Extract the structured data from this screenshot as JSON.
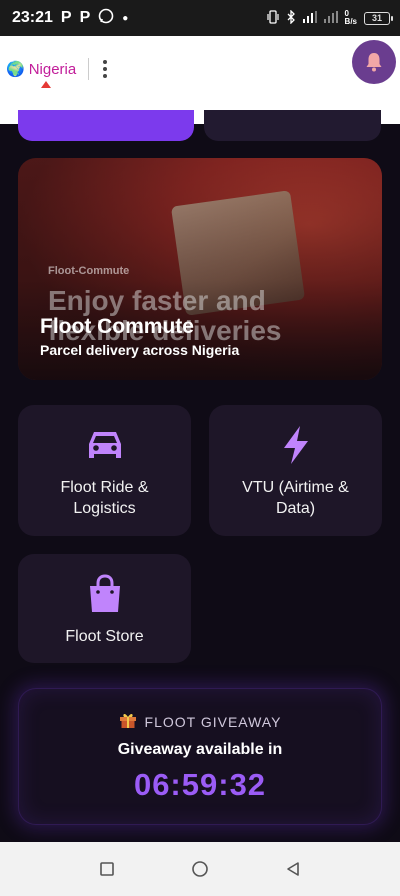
{
  "status_bar": {
    "time": "23:21",
    "app_icons": [
      "P",
      "P"
    ],
    "battery": "31"
  },
  "header": {
    "country": "Nigeria",
    "country_flag_icon": "globe-icon"
  },
  "banner": {
    "small_label": "Floot-Commute",
    "background_text": "Enjoy faster and flexible deliveries",
    "title": "Floot Commute",
    "subtitle": "Parcel delivery across Nigeria"
  },
  "services": [
    {
      "label": "Floot Ride & Logistics",
      "icon": "car-icon"
    },
    {
      "label": "VTU (Airtime & Data)",
      "icon": "lightning-icon"
    },
    {
      "label": "Floot Store",
      "icon": "shopping-bag-icon"
    }
  ],
  "giveaway": {
    "header": "FLOOT GIVEAWAY",
    "subtitle": "Giveaway available in",
    "timer": "06:59:32"
  },
  "colors": {
    "accent": "#7c3aed",
    "timer": "#9b5cf6",
    "card_bg": "#1e1628",
    "page_bg": "#0f0b16",
    "country_text": "#c21e9a"
  }
}
